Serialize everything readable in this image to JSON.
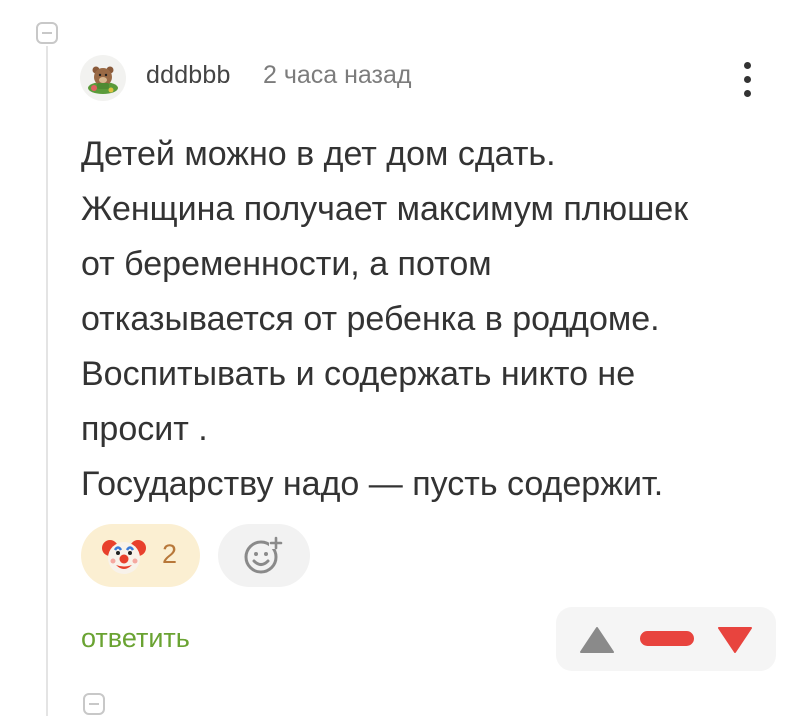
{
  "comment": {
    "username": "dddbbb",
    "time": "2 часа назад",
    "avatar_icon": "bear-avatar-icon",
    "body": [
      "Детей можно в дет дом сдать.",
      "Женщина получает максимум плюшек",
      "от беременности, а потом",
      "отказывается от ребенка в роддоме.",
      "Воспитывать и содержать никто не",
      "просит .",
      "Государству надо — пусть содержит."
    ],
    "reactions": [
      {
        "icon": "clown-face-icon",
        "count": "2",
        "bg_color": "#fbefd2",
        "count_color": "#b8783a"
      }
    ],
    "add_reaction_icon": "smile-plus-icon",
    "reply_label": "ответить",
    "reply_color": "#6aa332",
    "rating": {
      "upvote_icon": "triangle-up-icon",
      "downvote_icon": "triangle-down-icon",
      "score_color": "#e8443e",
      "up_color": "#8a8a8a"
    },
    "more_icon": "vertical-dots-icon"
  },
  "thread": {
    "collapse_icon": "minus-box-icon"
  }
}
